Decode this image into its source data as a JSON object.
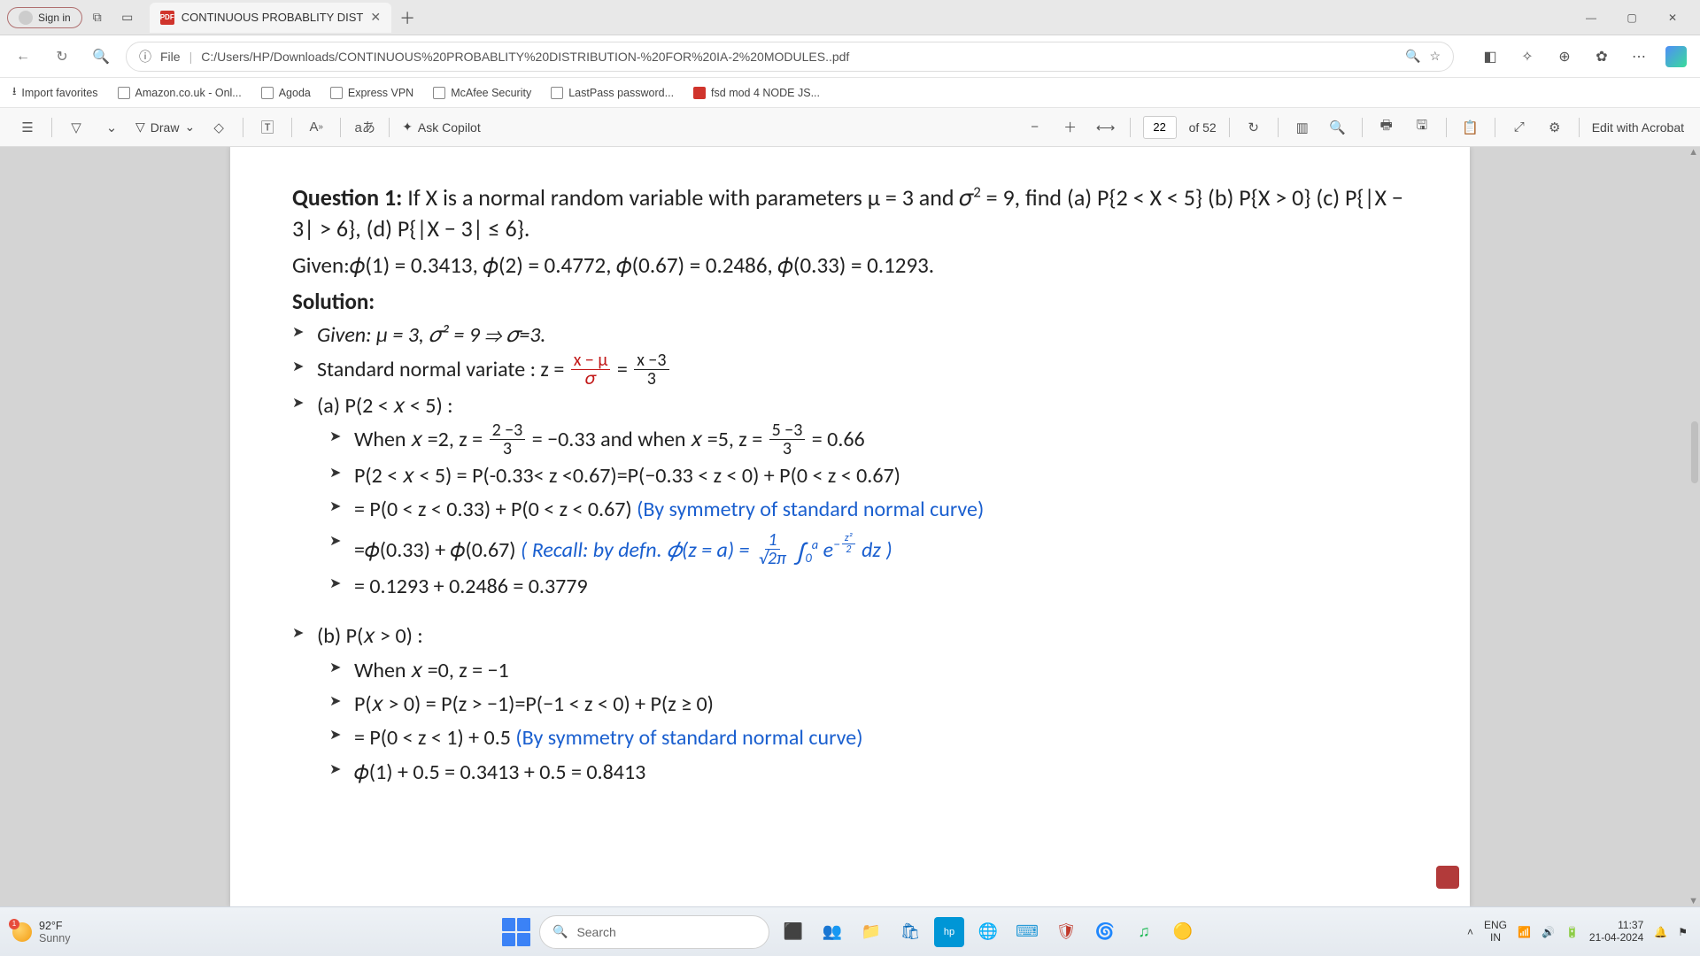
{
  "titlebar": {
    "signin": "Sign in",
    "tab_title": "CONTINUOUS PROBABLITY DIST"
  },
  "address": {
    "scheme": "File",
    "path": "C:/Users/HP/Downloads/CONTINUOUS%20PROBABLITY%20DISTRIBUTION-%20FOR%20IA-2%20MODULES..pdf"
  },
  "bookmarks": {
    "import": "Import favorites",
    "items": [
      "Amazon.co.uk - Onl...",
      "Agoda",
      "Express VPN",
      "McAfee Security",
      "LastPass password...",
      "fsd mod 4 NODE JS..."
    ]
  },
  "pdfbar": {
    "draw": "Draw",
    "ask": "Ask Copilot",
    "page": "22",
    "total": "of 52",
    "edit": "Edit with Acrobat"
  },
  "doc": {
    "q_label": "Question 1:",
    "q_text_1": " If X is a normal random variable with parameters μ = 3 and 𝜎",
    "q_text_2": " = 9, find (a) P{2 < X < 5}  (b) P{X > 0} (c) P{|X − 3| > 6}, (d) P{|X − 3| ≤ 6}.",
    "given": "Given:𝜙(1) = 0.3413, 𝜙(2) = 0.4772, 𝜙(0.67) = 0.2486, 𝜙(0.33) = 0.1293.",
    "solution": "Solution:",
    "b1": "Given: μ = 3, 𝜎² = 9 ⇒ 𝜎=3.",
    "b2_pre": "Standard normal variate : z = ",
    "b3": "(a) P(2 < 𝑥 < 5) :",
    "b3a_pre": "When 𝑥 =2, z = ",
    "b3a_mid": " = −0.33 and when 𝑥 =5, z = ",
    "b3a_post": " = 0.66",
    "b3b": "P(2 < 𝑥 < 5) = P(-0.33< z <0.67)=P(−0.33 < z < 0) + P(0 < z < 0.67)",
    "b3c_a": "= P(0 < z < 0.33) + P(0 < z < 0.67) ",
    "b3c_b": "(By symmetry of standard normal curve)",
    "b3d_a": "=𝜙(0.33) + 𝜙(0.67)   ",
    "b3d_b": "( Recall: by defn. 𝜙(z = a) =  ",
    "b3d_c": " dz )",
    "b3e": "= 0.1293 + 0.2486 = 0.3779",
    "b4": "(b) P(𝑥 > 0) :",
    "b4a": "When 𝑥 =0, z = −1",
    "b4b": "P(𝑥 > 0) = P(z > −1)=P(−1 < z < 0) + P(z ≥ 0)",
    "b4c_a": "= P(0 < z < 1) + 0.5 ",
    "b4c_b": "(By symmetry of standard normal curve)",
    "b4d": "𝜙(1) + 0.5 = 0.3413 + 0.5 = 0.8413",
    "frac": {
      "z_n": "x − μ",
      "z_d": "𝜎",
      "z2_n": "x −3",
      "z2_d": "3",
      "a_n": "2 −3",
      "a_d": "3",
      "b_n": "5 −3",
      "b_d": "3",
      "recall_n": "1",
      "recall_d": "√2π",
      "exp_n": "z²",
      "exp_d": "2",
      "int_top": "a",
      "int_bot": "0"
    }
  },
  "taskbar": {
    "temp": "92°F",
    "cond": "Sunny",
    "badge": "1",
    "search": "Search",
    "lang1": "ENG",
    "lang2": "IN",
    "time": "11:37",
    "date": "21-04-2024"
  }
}
